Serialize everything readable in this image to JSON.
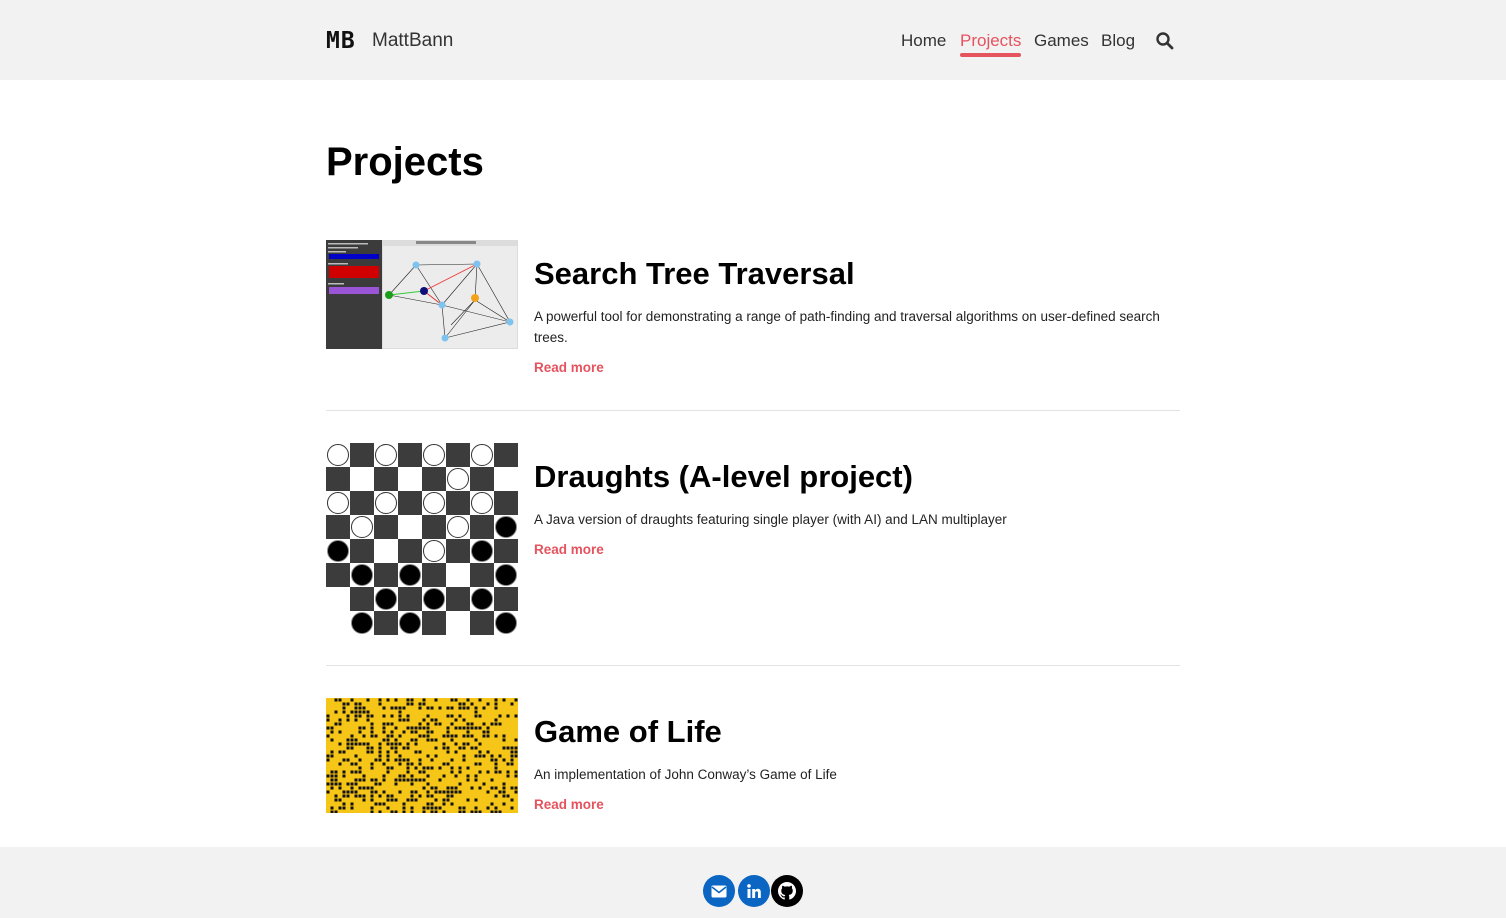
{
  "header": {
    "logo_mark": "MB",
    "site_name": "MattBann",
    "nav": [
      {
        "label": "Home",
        "active": false
      },
      {
        "label": "Projects",
        "active": true
      },
      {
        "label": "Games",
        "active": false
      },
      {
        "label": "Blog",
        "active": false
      }
    ],
    "search_icon": "search-icon"
  },
  "page": {
    "title": "Projects"
  },
  "projects": [
    {
      "title": "Search Tree Traversal",
      "description": "A powerful tool for demonstrating a range of path-finding and traversal algorithms on user-defined search trees.",
      "read_more": "Read more",
      "thumbnail": "graph-app-screenshot"
    },
    {
      "title": "Draughts (A-level project)",
      "description": "A Java version of draughts featuring single player (with AI) and LAN multiplayer",
      "read_more": "Read more",
      "thumbnail": "draughts-board"
    },
    {
      "title": "Game of Life",
      "description": "An implementation of John Conway’s Game of Life",
      "read_more": "Read more",
      "thumbnail": "game-of-life-grid"
    }
  ],
  "footer": {
    "social": [
      {
        "icon": "email-icon",
        "color": "#0a66c2"
      },
      {
        "icon": "linkedin-icon",
        "color": "#0a66c2"
      },
      {
        "icon": "github-icon",
        "color": "#000000"
      }
    ]
  },
  "colors": {
    "accent": "#e5535e",
    "header_bg": "#f2f2f2",
    "life_yellow": "#f5c518"
  }
}
